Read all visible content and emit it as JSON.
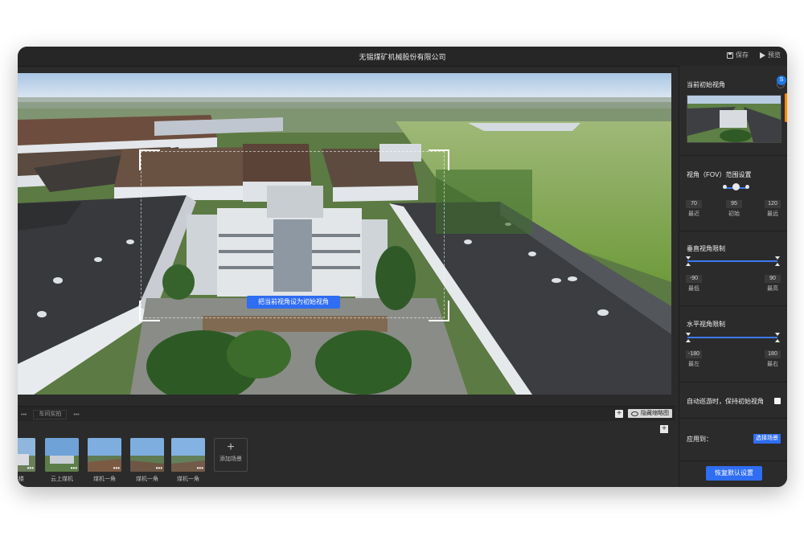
{
  "window": {
    "title": "无锡煤矿机械股份有限公司"
  },
  "toolbar": {
    "save_label": "保存",
    "preview_label": "预览"
  },
  "viewport": {
    "set_initial_button": "把当前视角设为初始视角"
  },
  "scene_bar": {
    "tab_label": "车间实拍",
    "hide_map_label": "隐藏缩略图"
  },
  "scenes": [
    {
      "label": "大楼"
    },
    {
      "label": "云上煤机"
    },
    {
      "label": "煤机一角"
    },
    {
      "label": "煤机一角"
    },
    {
      "label": "煤机一角"
    }
  ],
  "add_scene_label": "添加场景",
  "panel": {
    "initial_view_title": "当前初始视角",
    "fov": {
      "title": "视角（FOV）范围设置",
      "min": "70",
      "init": "95",
      "max": "120",
      "min_label": "最近",
      "init_label": "初始",
      "max_label": "最远",
      "range": [
        70,
        120
      ],
      "init_value": 95
    },
    "vertical": {
      "title": "垂直视角限制",
      "min": "-90",
      "max": "90",
      "min_label": "最低",
      "max_label": "最高"
    },
    "horizontal": {
      "title": "水平视角限制",
      "min": "-180",
      "max": "180",
      "min_label": "最左",
      "max_label": "最右"
    },
    "auto_tour_label": "自动巡游时，保持初始视角",
    "apply_label": "应用到：",
    "select_scene_button": "选择场景",
    "reset_button": "恢复默认设置"
  },
  "colors": {
    "accent": "#2f6df2",
    "panel_bg": "#2b2b2b",
    "topbar_bg": "#262626"
  }
}
